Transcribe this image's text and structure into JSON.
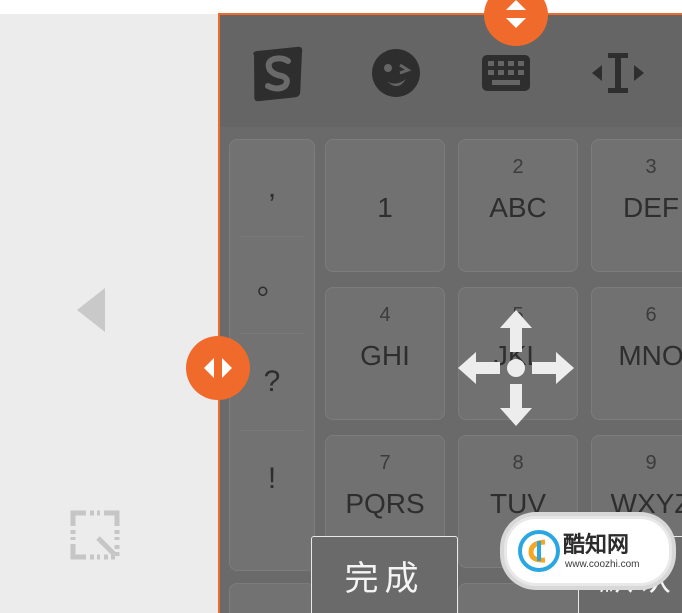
{
  "colors": {
    "accent": "#f06a2b",
    "keyboard_bg": "#6a6a6a",
    "toolbar_bg": "#656565",
    "key_bg": "#717171",
    "key_text": "#2e2e2e",
    "outer_bg": "#ececec"
  },
  "toolbar": {
    "icons": [
      "sogou-logo-icon",
      "emoji-icon",
      "keyboard-icon",
      "cursor-move-icon"
    ]
  },
  "punctuation": [
    ",",
    "。",
    "?",
    "!"
  ],
  "keys": [
    {
      "num": "",
      "label": "1"
    },
    {
      "num": "2",
      "label": "ABC"
    },
    {
      "num": "3",
      "label": "DEF"
    },
    {
      "num": "4",
      "label": "GHI"
    },
    {
      "num": "5",
      "label": "JKL"
    },
    {
      "num": "6",
      "label": "MNO"
    },
    {
      "num": "7",
      "label": "PQRS"
    },
    {
      "num": "8",
      "label": "TUV"
    },
    {
      "num": "9",
      "label": "WXYZ"
    }
  ],
  "buttons": {
    "done": "完成",
    "default": "默认"
  },
  "watermark": {
    "title": "酷知网",
    "url": "www.coozhi.com"
  }
}
